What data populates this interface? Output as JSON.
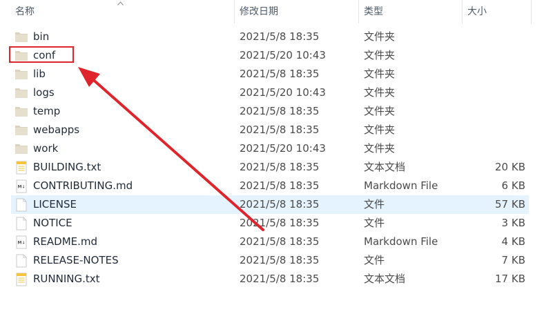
{
  "header": {
    "name": "名称",
    "date": "修改日期",
    "type": "类型",
    "size": "大小"
  },
  "files": [
    {
      "name": "bin",
      "date": "2021/5/8 18:35",
      "type": "文件夹",
      "size": "",
      "icon": "folder-icon"
    },
    {
      "name": "conf",
      "date": "2021/5/20 10:43",
      "type": "文件夹",
      "size": "",
      "icon": "folder-icon"
    },
    {
      "name": "lib",
      "date": "2021/5/8 18:35",
      "type": "文件夹",
      "size": "",
      "icon": "folder-icon"
    },
    {
      "name": "logs",
      "date": "2021/5/20 10:43",
      "type": "文件夹",
      "size": "",
      "icon": "folder-icon"
    },
    {
      "name": "temp",
      "date": "2021/5/8 18:35",
      "type": "文件夹",
      "size": "",
      "icon": "folder-icon"
    },
    {
      "name": "webapps",
      "date": "2021/5/8 18:35",
      "type": "文件夹",
      "size": "",
      "icon": "folder-icon"
    },
    {
      "name": "work",
      "date": "2021/5/20 10:43",
      "type": "文件夹",
      "size": "",
      "icon": "folder-icon"
    },
    {
      "name": "BUILDING.txt",
      "date": "2021/5/8 18:35",
      "type": "文本文档",
      "size": "20 KB",
      "icon": "text-file-icon"
    },
    {
      "name": "CONTRIBUTING.md",
      "date": "2021/5/8 18:35",
      "type": "Markdown File",
      "size": "6 KB",
      "icon": "markdown-file-icon"
    },
    {
      "name": "LICENSE",
      "date": "2021/5/8 18:35",
      "type": "文件",
      "size": "57 KB",
      "icon": "blank-file-icon",
      "selected": true
    },
    {
      "name": "NOTICE",
      "date": "2021/5/8 18:35",
      "type": "文件",
      "size": "3 KB",
      "icon": "blank-file-icon"
    },
    {
      "name": "README.md",
      "date": "2021/5/8 18:35",
      "type": "Markdown File",
      "size": "4 KB",
      "icon": "markdown-file-icon"
    },
    {
      "name": "RELEASE-NOTES",
      "date": "2021/5/8 18:35",
      "type": "文件",
      "size": "7 KB",
      "icon": "blank-file-icon"
    },
    {
      "name": "RUNNING.txt",
      "date": "2021/5/8 18:35",
      "type": "文本文档",
      "size": "17 KB",
      "icon": "text-file-icon"
    }
  ],
  "annotation": {
    "highlighted": "conf",
    "color": "#e0242b"
  }
}
